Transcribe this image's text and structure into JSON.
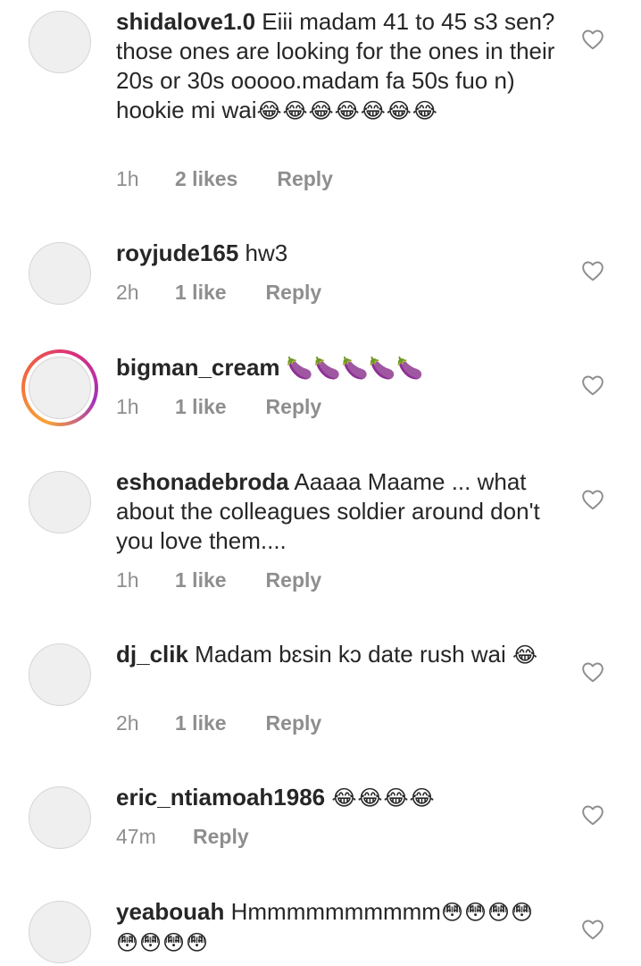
{
  "comments": [
    {
      "username": "shidalove1.0",
      "text": " Eiii madam 41 to 45 s3 sen?those ones are looking for the ones in their 20s or 30s ooooo.madam fa 50s fuo n) hookie mi wai",
      "emoji": "😂😂😂😂😂😂😂",
      "time": "1h",
      "likes": "2 likes",
      "reply": "Reply"
    },
    {
      "username": "royjude165",
      "text": " hw3",
      "emoji": "",
      "time": "2h",
      "likes": "1 like",
      "reply": "Reply"
    },
    {
      "username": "bigman_cream",
      "text": " ",
      "emoji": "🍆🍆🍆🍆🍆",
      "time": "1h",
      "likes": "1 like",
      "reply": "Reply"
    },
    {
      "username": "eshonadebroda",
      "text": " Aaaaa Maame ... what about the colleagues soldier around don't you love them....",
      "emoji": "",
      "time": "1h",
      "likes": "1 like",
      "reply": "Reply"
    },
    {
      "username": "dj_clik",
      "text": " Madam bɛsin kɔ date rush wai",
      "emoji": "😂",
      "time": "2h",
      "likes": "1 like",
      "reply": "Reply"
    },
    {
      "username": "eric_ntiamoah1986",
      "text": " ",
      "emoji": "😂😂😂😂",
      "time": "47m",
      "likes": "",
      "reply": "Reply"
    },
    {
      "username": "yeabouah",
      "text": " Hmmmmmmmmmm",
      "emoji": "😳😳😳😳😳😳😳😳",
      "time": "",
      "likes": "",
      "reply": ""
    }
  ],
  "icons": {
    "like": "heart-outline-icon",
    "story_ring_colors": [
      "#f7a33a",
      "#dc2f7b",
      "#a232b9"
    ]
  }
}
